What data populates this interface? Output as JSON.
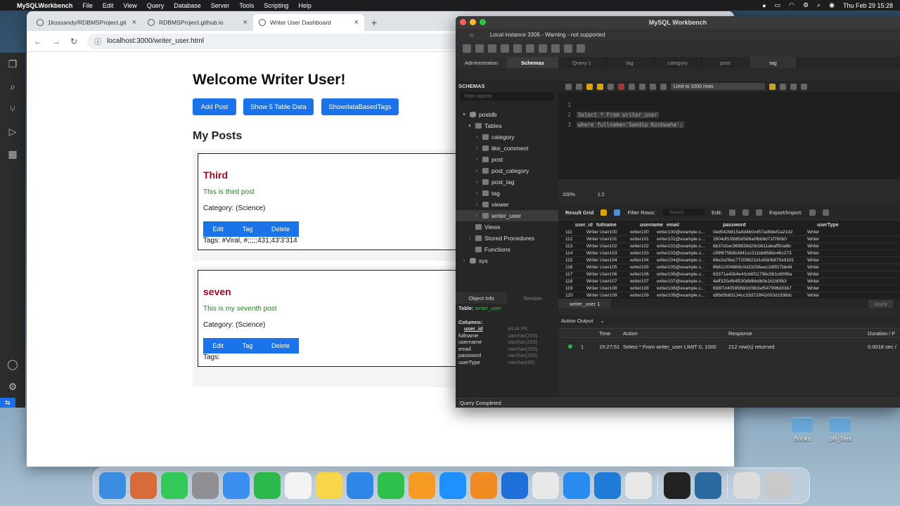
{
  "menubar": {
    "app": "MySQLWorkbench",
    "items": [
      "File",
      "Edit",
      "View",
      "Query",
      "Database",
      "Server",
      "Tools",
      "Scripting",
      "Help"
    ],
    "datetime": "Thu Feb 29  15:28"
  },
  "browser": {
    "tabs": [
      {
        "title": "1kussandy/RDBMSProject.git"
      },
      {
        "title": "RDBMSProject.github.io"
      },
      {
        "title": "Writer User Dashboard"
      }
    ],
    "url": "localhost:3000/writer_user.html"
  },
  "page": {
    "heading": "Welcome Writer User!",
    "buttons": [
      "Add Post",
      "Show 5 Table Data",
      "ShowdataBasedTags"
    ],
    "section_title": "My Posts",
    "posts": [
      {
        "title": "Third",
        "content": "This is third post",
        "category": "Category: (Science)",
        "actions": [
          "Edit",
          "Tag",
          "Delete"
        ],
        "tags": "Tags: #Viral, #;;;;;431;43'3'314"
      },
      {
        "title": "seven",
        "content": "This is my seventh post",
        "category": "Category: (Science)",
        "actions": [
          "Edit",
          "Tag",
          "Delete"
        ],
        "tags": "Tags:"
      }
    ]
  },
  "workbench": {
    "title": "MySQL Workbench",
    "connection": "Local instance 3306 - Warning - not supported",
    "sidebar_tabs": [
      "Administration",
      "Schemas"
    ],
    "query_tabs": [
      "Query 1",
      "tag",
      "category",
      "post",
      "tag"
    ],
    "schemas_header": "SCHEMAS",
    "filter_placeholder": "Filter objects",
    "tree": [
      {
        "label": "postdb",
        "level": 0
      },
      {
        "label": "Tables",
        "level": 1
      },
      {
        "label": "category",
        "level": 2
      },
      {
        "label": "like_comment",
        "level": 2
      },
      {
        "label": "post",
        "level": 2
      },
      {
        "label": "post_category",
        "level": 2
      },
      {
        "label": "post_tag",
        "level": 2
      },
      {
        "label": "tag",
        "level": 2
      },
      {
        "label": "viewer",
        "level": 2
      },
      {
        "label": "writer_user",
        "level": 2
      },
      {
        "label": "Views",
        "level": 1
      },
      {
        "label": "Stored Procedures",
        "level": 1
      },
      {
        "label": "Functions",
        "level": 1
      },
      {
        "label": "sys",
        "level": 0
      }
    ],
    "limit": "Limit to 1000 rows",
    "editor_lines": [
      {
        "n": "1",
        "text": ""
      },
      {
        "n": "2",
        "text": "Select * From writer_user"
      },
      {
        "n": "3",
        "text": "where fullname='Sandip Kushwaha';"
      }
    ],
    "zoom": "100%",
    "cursor": "1:2",
    "result_grid_label": "Result Grid",
    "filter_rows_label": "Filter Rows:",
    "search_placeholder": "Search",
    "edit_label": "Edit:",
    "export_label": "Export/Import:",
    "grid_columns": [
      "user_id",
      "fullname",
      "username",
      "email",
      "password",
      "userType"
    ],
    "grid_rows": [
      [
        "111",
        "Writer User100",
        "writer100",
        "writer100@example.c...",
        "0ed542b815a0d4b0c457ad9def1a21d2",
        "Writer"
      ],
      [
        "112",
        "Writer User101",
        "writer101",
        "writer101@example.c...",
        "2804df10fd85d566a0fbb8d71f760b0",
        "Writer"
      ],
      [
        "113",
        "Writer User102",
        "writer102",
        "writer102@example.c...",
        "6b37d1ec969838d29cb611deaff50a6b",
        "Writer"
      ],
      [
        "114",
        "Writer User103",
        "writer103",
        "writer103@example.c...",
        "c99f6758db3841cc311bb858bc46c273",
        "Writer"
      ],
      [
        "115",
        "Writer User104",
        "writer104",
        "writer104@example.c...",
        "86e2e09ac77208621d1e5b0b870e9181",
        "Writer"
      ],
      [
        "116",
        "Writer User105",
        "writer105",
        "writer105@example.c...",
        "8b811004869c0d33256eec2df927bb48",
        "Writer"
      ],
      [
        "117",
        "Writer User106",
        "writer106",
        "writer106@example.c...",
        "83371a42b4e43cb6f11796c561c6096a",
        "Writer"
      ],
      [
        "118",
        "Writer User107",
        "writer107",
        "writer107@example.c...",
        "4eff325ef64f530dbfbbdb0e161b0fb3",
        "Writer"
      ],
      [
        "119",
        "Writer User108",
        "writer108",
        "writer108@example.c...",
        "698f7d405956b0c09b3ef547996d33b7",
        "Writer"
      ],
      [
        "120",
        "Writer User109",
        "writer109",
        "writer109@example.c...",
        "d89d5b83134cc33d728f41003d1936dc",
        "Writer"
      ]
    ],
    "result_tab": "writer_user 1",
    "apply_label": "Apply",
    "object_info_tabs": [
      "Object Info",
      "Session"
    ],
    "object_info": {
      "table_label": "Table:",
      "table_name": "writer_user",
      "columns_label": "Columns:",
      "columns": [
        {
          "name": "user_id",
          "type": "int AI PK"
        },
        {
          "name": "fullname",
          "type": "varchar(255)"
        },
        {
          "name": "username",
          "type": "varchar(255)"
        },
        {
          "name": "email",
          "type": "varchar(255)"
        },
        {
          "name": "password",
          "type": "varchar(255)"
        },
        {
          "name": "userType",
          "type": "varchar(45)"
        }
      ]
    },
    "output_label": "Action Output",
    "output_columns": [
      "Time",
      "Action",
      "Response",
      "Duration / F"
    ],
    "output_row": {
      "n": "1",
      "time": "15:27:51",
      "action": "Select * From writer_user LIMIT 0, 1000",
      "response": "212 row(s) returned",
      "duration": "0.0018 sec /"
    },
    "status": "Query Completed"
  },
  "desktop_icons": [
    "Books",
    "pfs_files"
  ],
  "dock": [
    {
      "name": "finder",
      "color": "#3a8de0"
    },
    {
      "name": "launchpad",
      "color": "#d86b3a"
    },
    {
      "name": "messages",
      "color": "#34c759"
    },
    {
      "name": "settings",
      "color": "#8e8e93"
    },
    {
      "name": "mail",
      "color": "#3b8ff0"
    },
    {
      "name": "facetime",
      "color": "#2db84b"
    },
    {
      "name": "reminders",
      "color": "#f2f2f2"
    },
    {
      "name": "notes",
      "color": "#f7d64a"
    },
    {
      "name": "keynote",
      "color": "#2d86e8"
    },
    {
      "name": "numbers",
      "color": "#2fbf4b"
    },
    {
      "name": "pages",
      "color": "#f59a23"
    },
    {
      "name": "appstore",
      "color": "#1e90ff"
    },
    {
      "name": "books",
      "color": "#f28b22"
    },
    {
      "name": "app-1",
      "color": "#1f6fd8"
    },
    {
      "name": "vim",
      "color": "#e8e8e8"
    },
    {
      "name": "safari",
      "color": "#2a8cf0"
    },
    {
      "name": "vscode",
      "color": "#1e7bd6"
    },
    {
      "name": "chrome",
      "color": "#e8e8e8"
    },
    {
      "name": "terminal",
      "color": "#222222"
    },
    {
      "name": "mysql-workbench",
      "color": "#2b6aa0"
    },
    {
      "name": "documents",
      "color": "#dcdcdc"
    },
    {
      "name": "trash",
      "color": "#c9c9c9"
    }
  ]
}
